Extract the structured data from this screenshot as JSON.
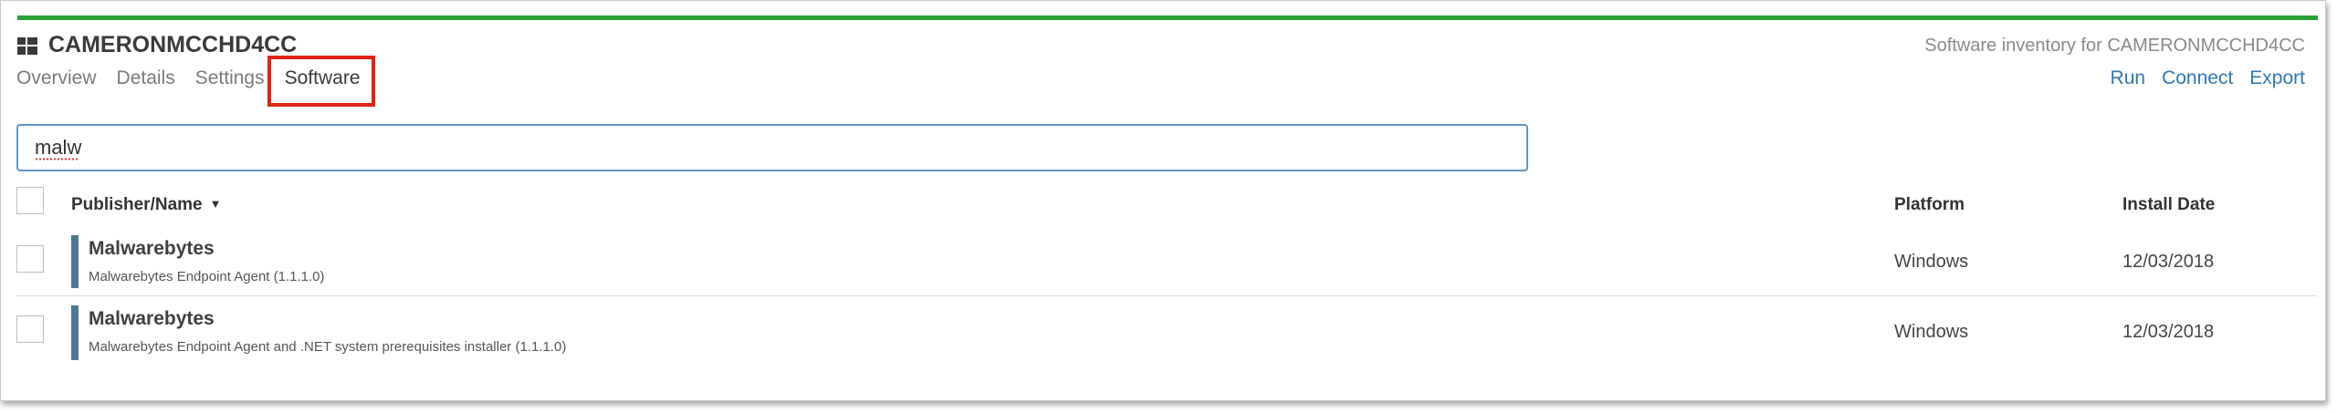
{
  "header": {
    "device_name": "CAMERONMCCHD4CC",
    "inventory_title": "Software inventory for CAMERONMCCHD4CC"
  },
  "tabs": [
    {
      "label": "Overview"
    },
    {
      "label": "Details"
    },
    {
      "label": "Settings"
    },
    {
      "label": "Software",
      "active": true
    }
  ],
  "actions": {
    "run": "Run",
    "connect": "Connect",
    "export": "Export"
  },
  "search": {
    "value": "malw"
  },
  "table": {
    "columns": {
      "publisher_name": "Publisher/Name",
      "platform": "Platform",
      "install_date": "Install Date"
    },
    "rows": [
      {
        "title": "Malwarebytes",
        "subtitle": "Malwarebytes Endpoint Agent (1.1.1.0)",
        "platform": "Windows",
        "install_date": "12/03/2018"
      },
      {
        "title": "Malwarebytes",
        "subtitle": "Malwarebytes Endpoint Agent and .NET system prerequisites installer (1.1.1.0)",
        "platform": "Windows",
        "install_date": "12/03/2018"
      }
    ]
  },
  "colors": {
    "top_bar": "#2aa035",
    "link": "#2f78b7",
    "highlight": "#e02214",
    "row_marker": "#4d7890"
  },
  "icons": {
    "device": "windows-logo-icon",
    "sort": "sort-down-icon"
  }
}
